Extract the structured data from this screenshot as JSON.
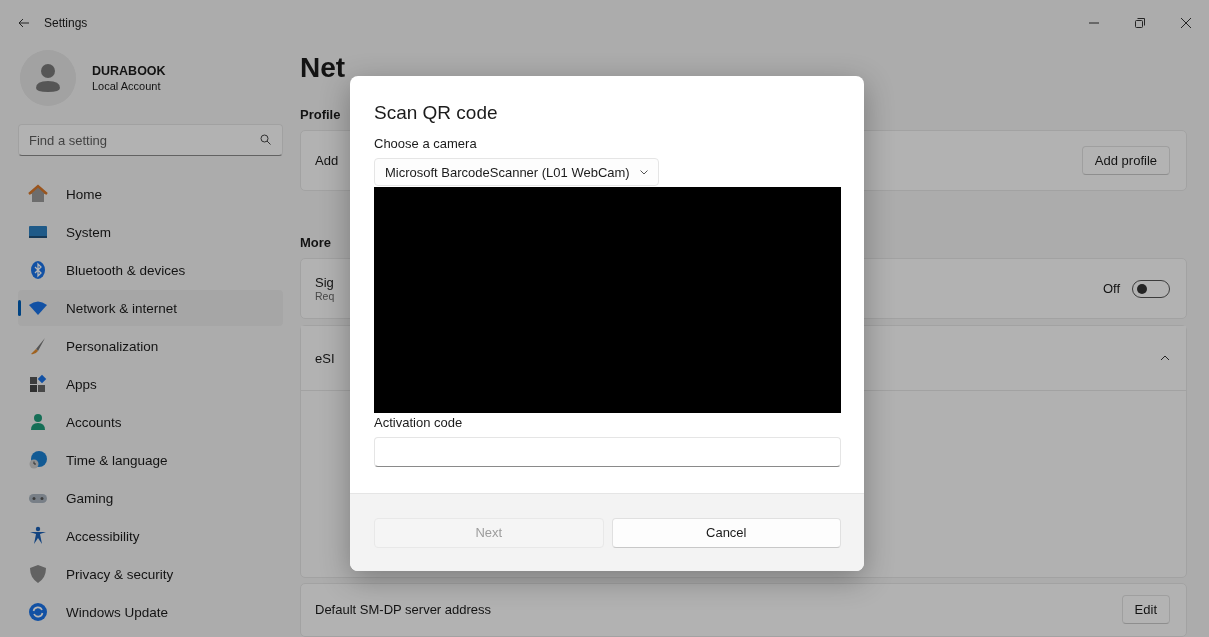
{
  "window": {
    "title": "Settings"
  },
  "user": {
    "name": "DURABOOK",
    "account": "Local Account"
  },
  "search": {
    "placeholder": "Find a setting"
  },
  "sidebar": {
    "items": [
      {
        "label": "Home",
        "selected": false
      },
      {
        "label": "System",
        "selected": false
      },
      {
        "label": "Bluetooth & devices",
        "selected": false
      },
      {
        "label": "Network & internet",
        "selected": true
      },
      {
        "label": "Personalization",
        "selected": false
      },
      {
        "label": "Apps",
        "selected": false
      },
      {
        "label": "Accounts",
        "selected": false
      },
      {
        "label": "Time & language",
        "selected": false
      },
      {
        "label": "Gaming",
        "selected": false
      },
      {
        "label": "Accessibility",
        "selected": false
      },
      {
        "label": "Privacy & security",
        "selected": false
      },
      {
        "label": "Windows Update",
        "selected": false
      }
    ]
  },
  "content": {
    "heading": "Net",
    "profiles_label": "Profile",
    "add_card": {
      "label": "Add",
      "button": "Add profile"
    },
    "more_label": "More",
    "signal_card": {
      "title": "Sig",
      "subtitle": "Req",
      "toggle_label": "Off",
      "on": false
    },
    "esim_card": {
      "label": "eSI",
      "expanded": true
    },
    "smdp_card": {
      "label": "Default SM-DP server address",
      "button": "Edit"
    }
  },
  "dialog": {
    "title": "Scan QR code",
    "camera_label": "Choose a camera",
    "camera_value": "Microsoft BarcodeScanner (L01 WebCam)",
    "activation_label": "Activation code",
    "buttons": [
      {
        "label": "Next",
        "disabled": true
      },
      {
        "label": "Cancel",
        "disabled": false
      }
    ]
  }
}
